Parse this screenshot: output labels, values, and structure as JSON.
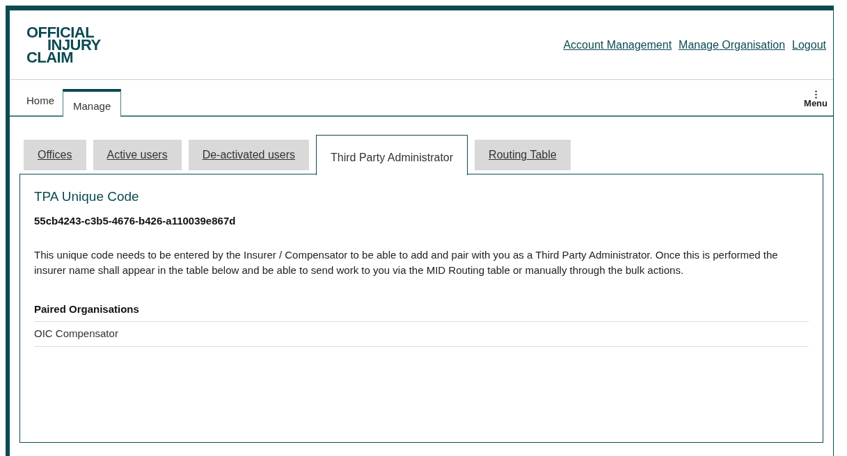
{
  "logo": {
    "lines": [
      "OFFICIAL",
      "INJURY",
      "CLAIM"
    ]
  },
  "header_links": [
    "Account Management",
    "Manage Organisation",
    "Logout"
  ],
  "nav_tabs": [
    {
      "label": "Home",
      "selected": false
    },
    {
      "label": "Manage",
      "selected": true
    }
  ],
  "menu": {
    "label": "Menu"
  },
  "tabs": [
    {
      "label": "Offices",
      "selected": false
    },
    {
      "label": "Active users",
      "selected": false
    },
    {
      "label": "De-activated users",
      "selected": false
    },
    {
      "label": "Third Party Administrator",
      "selected": true
    },
    {
      "label": "Routing Table",
      "selected": false
    }
  ],
  "panel": {
    "title": "TPA Unique Code",
    "code": "55cb4243-c3b5-4676-b426-a110039e867d",
    "description": "This unique code needs to be entered by the Insurer / Compensator to be able to add and pair with you as a Third Party Administrator.  Once this is performed the insurer name shall appear in the table below and be able to send work to you via the MID Routing table or manually through the bulk actions.",
    "table": {
      "columns": [
        "Paired Organisations"
      ],
      "rows": [
        [
          "OIC Compensator"
        ]
      ]
    }
  }
}
